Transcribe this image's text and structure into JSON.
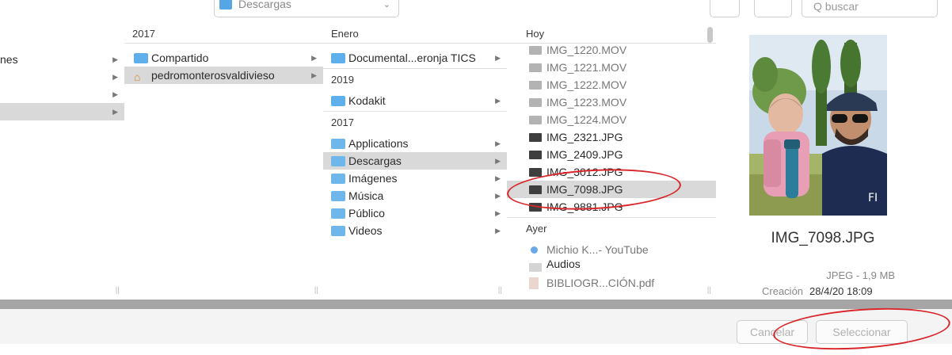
{
  "toolbar": {
    "location": "Descargas",
    "search_placeholder": "Q buscar"
  },
  "columns": {
    "c1": {
      "items": [
        {
          "label": "nes"
        }
      ]
    },
    "c2": {
      "header": "2017",
      "items": [
        {
          "label": "Compartido"
        },
        {
          "label": "pedromonterosvaldivieso"
        }
      ]
    },
    "c3": {
      "header": "Enero",
      "items_top": [
        {
          "label": "Documental...eronja TICS"
        }
      ],
      "section_2019": "2019",
      "items_2019": [
        {
          "label": "Kodakit"
        }
      ],
      "section_2017": "2017",
      "items_2017": [
        {
          "label": "Applications"
        },
        {
          "label": "Descargas"
        },
        {
          "label": "Imágenes"
        },
        {
          "label": "Música"
        },
        {
          "label": "Público"
        },
        {
          "label": "Videos"
        }
      ]
    },
    "c4": {
      "header": "Hoy",
      "files": [
        {
          "name": "IMG_1220.MOV",
          "type": "mov"
        },
        {
          "name": "IMG_1221.MOV",
          "type": "mov"
        },
        {
          "name": "IMG_1222.MOV",
          "type": "mov"
        },
        {
          "name": "IMG_1223.MOV",
          "type": "mov"
        },
        {
          "name": "IMG_1224.MOV",
          "type": "mov"
        },
        {
          "name": "IMG_2321.JPG",
          "type": "jpg"
        },
        {
          "name": "IMG_2409.JPG",
          "type": "jpg"
        },
        {
          "name": "IMG_3012.JPG",
          "type": "jpg"
        },
        {
          "name": "IMG_7098.JPG",
          "type": "jpg"
        },
        {
          "name": "IMG_9881.JPG",
          "type": "jpg"
        }
      ],
      "section_ayer": "Ayer",
      "ayer_items": [
        {
          "name": "Michio K...- YouTube"
        },
        {
          "name": "Audios"
        },
        {
          "name": "BIBLIOGR...CIÓN.pdf"
        }
      ]
    }
  },
  "preview": {
    "filename": "IMG_7098.JPG",
    "kind_size": "JPEG - 1,9 MB",
    "created_label": "Creación",
    "created_value": "28/4/20 18:09"
  },
  "buttons": {
    "cancel": "Cancelar",
    "select": "Seleccionar"
  },
  "colors": {
    "annotation_red": "#d9262b",
    "selection_gray": "#d9d9d9",
    "folder_blue": "#5eb0ec"
  }
}
